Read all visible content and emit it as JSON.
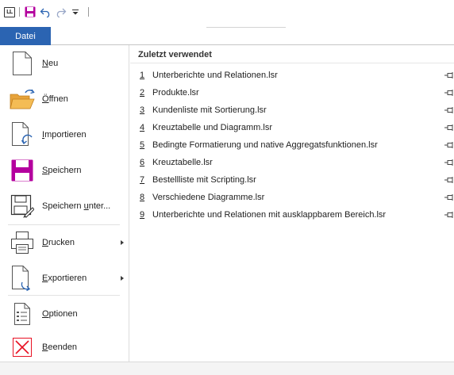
{
  "quick_access": {
    "logo_text": "LL",
    "icons": [
      "app-logo",
      "save-icon",
      "undo-icon",
      "redo-icon",
      "customize-qat-icon"
    ]
  },
  "ribbon": {
    "file_tab_label": "Datei"
  },
  "menu": {
    "new": {
      "label_hot": "N",
      "label_rest": "eu"
    },
    "open": {
      "label_hot": "Ö",
      "label_rest": "ffnen"
    },
    "import": {
      "label_pre": "",
      "label_hot": "I",
      "label_rest": "mportieren"
    },
    "save": {
      "label_hot": "S",
      "label_rest": "peichern"
    },
    "save_as": {
      "label_pre": "Speichern ",
      "label_hot": "u",
      "label_rest": "nter..."
    },
    "print": {
      "label_hot": "D",
      "label_rest": "rucken"
    },
    "export": {
      "label_hot": "E",
      "label_rest": "xportieren"
    },
    "options": {
      "label_hot": "O",
      "label_rest": "ptionen"
    },
    "exit": {
      "label_hot": "B",
      "label_rest": "eenden"
    }
  },
  "recent": {
    "header": "Zuletzt verwendet",
    "files": [
      {
        "num": "1",
        "name": "Unterberichte und Relationen.lsr"
      },
      {
        "num": "2",
        "name": "Produkte.lsr"
      },
      {
        "num": "3",
        "name": "Kundenliste mit Sortierung.lsr"
      },
      {
        "num": "4",
        "name": "Kreuztabelle und Diagramm.lsr"
      },
      {
        "num": "5",
        "name": "Bedingte Formatierung und native Aggregatsfunktionen.lsr"
      },
      {
        "num": "6",
        "name": "Kreuztabelle.lsr"
      },
      {
        "num": "7",
        "name": "Bestellliste mit Scripting.lsr"
      },
      {
        "num": "8",
        "name": "Verschiedene Diagramme.lsr"
      },
      {
        "num": "9",
        "name": "Unterberichte und Relationen mit ausklappbarem Bereich.lsr"
      }
    ]
  },
  "colors": {
    "file_tab": "#2b64b2",
    "save_purple": "#b4009e",
    "exit_red": "#e81123",
    "folder_orange": "#f0a030",
    "accent_blue": "#2b64b2"
  }
}
